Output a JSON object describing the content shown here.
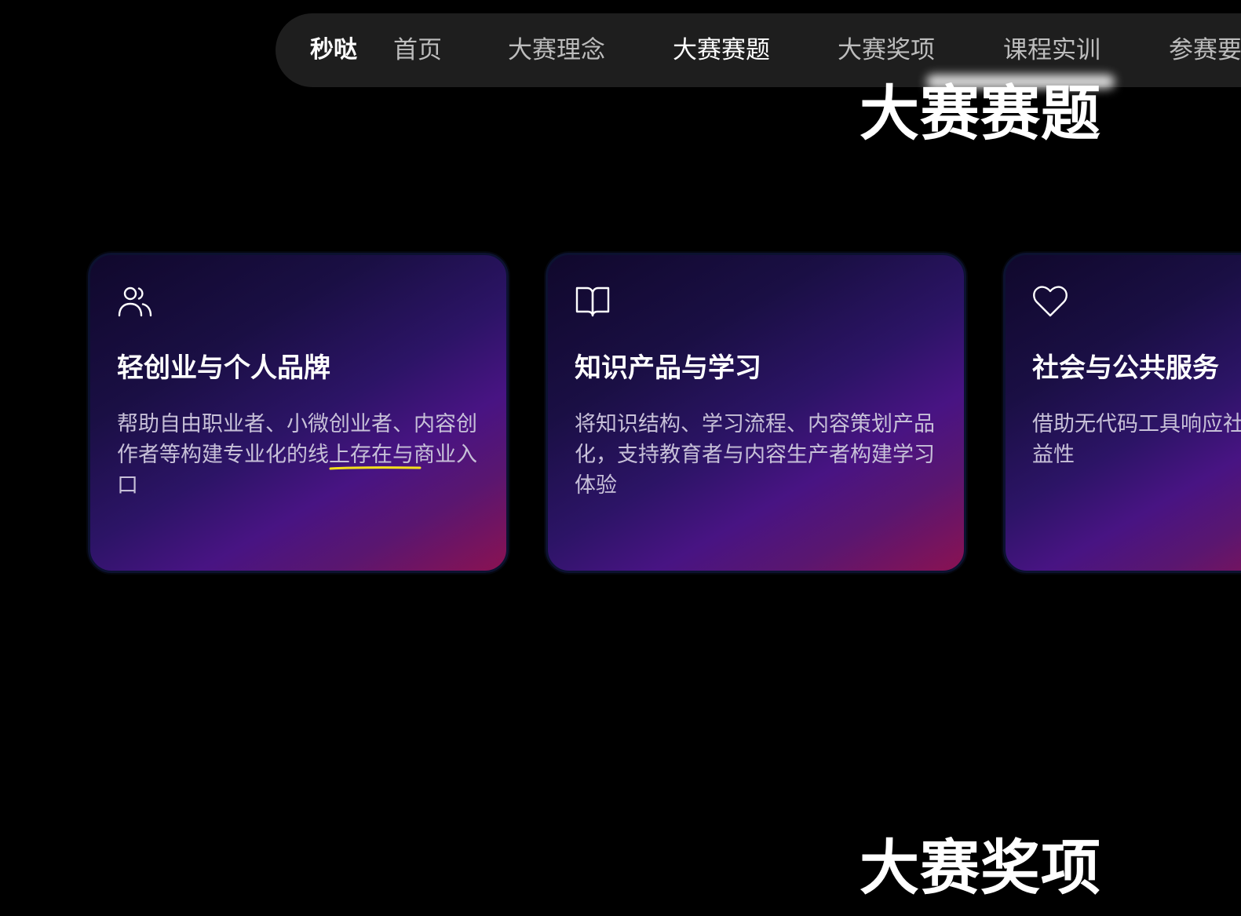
{
  "nav": {
    "brand": "秒哒",
    "items": [
      {
        "label": "首页",
        "active": false
      },
      {
        "label": "大赛理念",
        "active": false
      },
      {
        "label": "大赛赛题",
        "active": true
      },
      {
        "label": "大赛奖项",
        "active": false
      },
      {
        "label": "课程实训",
        "active": false
      },
      {
        "label": "参赛要",
        "active": false
      }
    ]
  },
  "sections": {
    "topics_title": "大赛赛题",
    "awards_title": "大赛奖项"
  },
  "cards": [
    {
      "icon": "users-icon",
      "title": "轻创业与个人品牌",
      "desc": "帮助自由职业者、小微创业者、内容创作者等构建专业化的线上存在与商业入口"
    },
    {
      "icon": "book-open-icon",
      "title": "知识产品与学习",
      "desc": "将知识结构、学习流程、内容策划产品化，支持教育者与内容生产者构建学习体验"
    },
    {
      "icon": "heart-icon",
      "title": "社会与公共服务",
      "desc": "借助无代码工具响应社会需求，提升公共参与、公益性"
    }
  ],
  "colors": {
    "background": "#000000",
    "nav_bg": "#1e1e1e",
    "highlight_underline": "#f5e11c"
  }
}
